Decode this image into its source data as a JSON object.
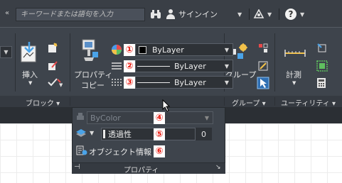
{
  "titlebar": {
    "search_placeholder": "キーワードまたは語句を入力",
    "search_chevron": "«",
    "signin_label": "サインイン",
    "help_glyph": "?",
    "icons": [
      "binoculars-icon",
      "user-icon",
      "a360-icon",
      "help-icon"
    ]
  },
  "ribbon": {
    "insert_label": "挿入",
    "block_panel_label": "ブロック",
    "match_properties_label_line1": "プロパティ",
    "match_properties_label_line2": "コピー",
    "group_label": "グループ",
    "group_panel_label": "グループ",
    "measure_label": "計測",
    "utility_panel_label": "ユーティリティ"
  },
  "properties": {
    "color": {
      "badge": "①",
      "value": "ByLayer"
    },
    "linetype": {
      "badge": "②",
      "value": "ByLayer"
    },
    "lineweight": {
      "badge": "③",
      "value": "ByLayer"
    },
    "plotstyle": {
      "badge": "④",
      "value": "ByColor"
    },
    "transparency": {
      "badge": "⑤",
      "label": "透過性",
      "value": "0"
    },
    "object_info": {
      "badge": "⑥",
      "label": "オブジェクト情報"
    },
    "panel_label": "プロパティ",
    "panel_pin_glyph": "⊣",
    "panel_launcher_glyph": "↘"
  },
  "colors": {
    "titlebar_bg": "#3a3f46",
    "ribbon_bg": "#3e444c",
    "combo_bg": "#2e3237",
    "badge_text": "#e8190f",
    "canvas_bg": "#ffffff"
  }
}
